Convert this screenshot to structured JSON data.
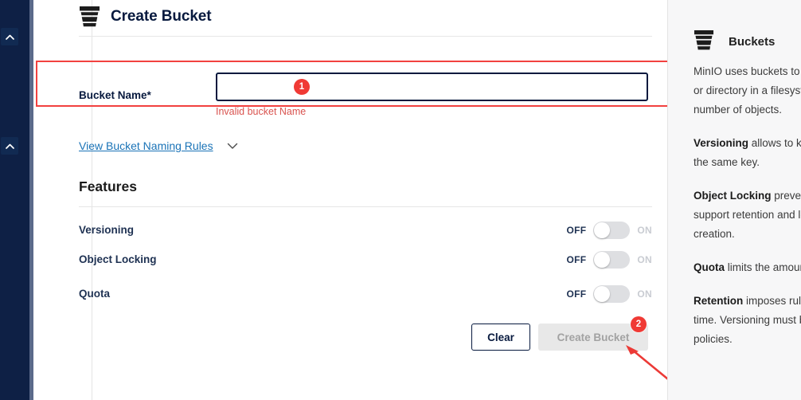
{
  "nav": {
    "rail_chevron_top_icon": "chevron-up-icon",
    "rail_chevron_bottom_icon": "chevron-up-icon"
  },
  "header": {
    "title": "Create Bucket",
    "icon": "bucket-icon"
  },
  "form": {
    "bucket_name_label": "Bucket Name*",
    "bucket_name_value": "",
    "bucket_name_placeholder": "",
    "error_message": "Invalid bucket Name",
    "naming_rules_link": "View Bucket Naming Rules",
    "naming_rules_icon": "chevron-down-icon",
    "features_heading": "Features",
    "features": [
      {
        "name": "Versioning",
        "off_label": "OFF",
        "on_label": "ON",
        "state": "off"
      },
      {
        "name": "Object Locking",
        "off_label": "OFF",
        "on_label": "ON",
        "state": "off"
      },
      {
        "name": "Quota",
        "off_label": "OFF",
        "on_label": "ON",
        "state": "off"
      }
    ],
    "clear_button": "Clear",
    "create_button": "Create Bucket"
  },
  "annotations": {
    "badge_1": "1",
    "badge_2": "2",
    "arrow_icon": "arrow-pointer-icon",
    "highlight_color": "#f2413f",
    "badge_color": "#f03a35"
  },
  "help": {
    "icon": "bucket-icon",
    "title": "Buckets",
    "paragraphs": [
      {
        "lead": "",
        "text": "MinIO uses buckets to organize objects. A bucket is similar to a folder or directory in a filesystem, where each bucket can hold an arbitrary number of objects."
      },
      {
        "lead": "Versioning",
        "text": " allows to keep multiple versions of the same object under the same key."
      },
      {
        "lead": "Object Locking",
        "text": " prevents objects from being deleted. Required to support retention and legal hold. Can only be enabled at bucket creation."
      },
      {
        "lead": "Quota",
        "text": " limits the amount of data in the bucket."
      },
      {
        "lead": "Retention",
        "text": " imposes rules to prevent object deletion for a period of time. Versioning must be enabled in order to set bucket retention policies."
      }
    ]
  }
}
